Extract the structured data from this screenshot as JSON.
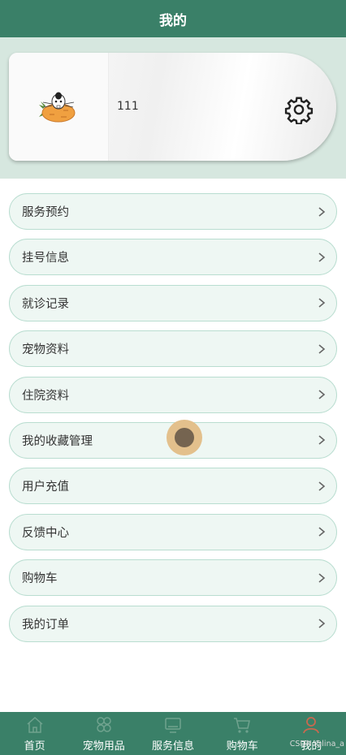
{
  "header": {
    "title": "我的"
  },
  "profile": {
    "username": "111",
    "avatar_icon": "rabbit-carrot-avatar",
    "settings_icon": "gear-icon"
  },
  "menu": [
    {
      "label": "服务预约"
    },
    {
      "label": "挂号信息"
    },
    {
      "label": "就诊记录"
    },
    {
      "label": "宠物资料"
    },
    {
      "label": "住院资料"
    },
    {
      "label": "我的收藏管理"
    },
    {
      "label": "用户充值"
    },
    {
      "label": "反馈中心"
    },
    {
      "label": "购物车"
    },
    {
      "label": "我的订单"
    }
  ],
  "tabbar": [
    {
      "label": "首页",
      "icon": "home-icon"
    },
    {
      "label": "宠物用品",
      "icon": "flower-icon"
    },
    {
      "label": "服务信息",
      "icon": "monitor-icon"
    },
    {
      "label": "购物车",
      "icon": "cart-icon"
    },
    {
      "label": "我的",
      "icon": "user-icon",
      "active": true
    }
  ],
  "watermark": "CSDN @lina_a",
  "colors": {
    "primary": "#3a8068",
    "band": "#d6e7df",
    "item_bg": "#eef7f3",
    "item_border": "#b9ddd0",
    "active_tab": "#c8694f"
  }
}
